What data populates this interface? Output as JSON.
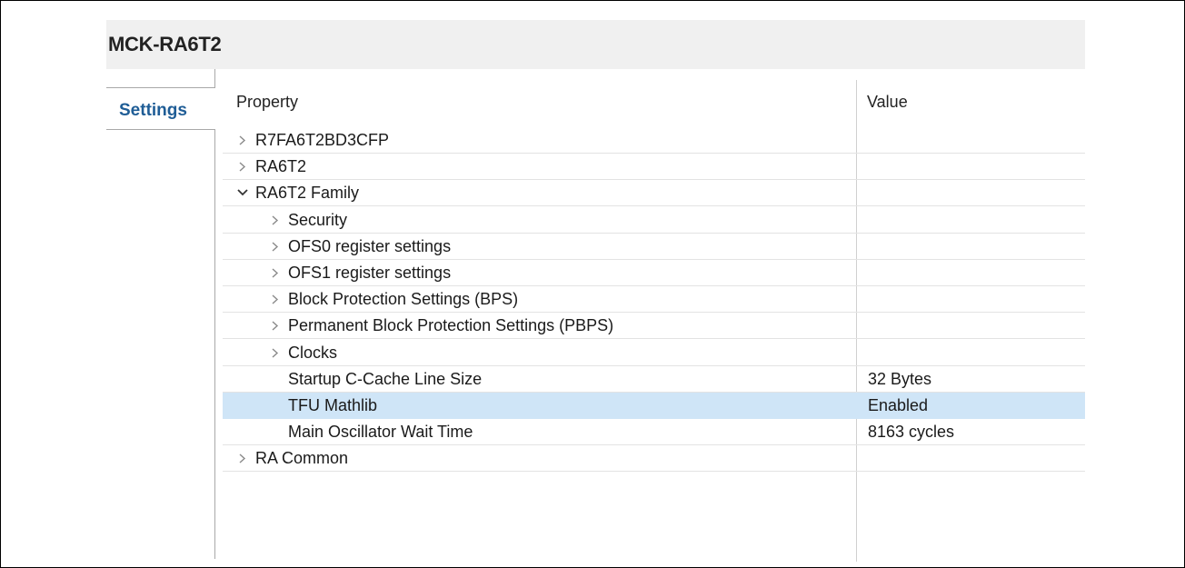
{
  "window": {
    "title": "MCK-RA6T2"
  },
  "tabs": [
    {
      "label": "Settings",
      "active": true
    }
  ],
  "table": {
    "headers": {
      "property": "Property",
      "value": "Value"
    },
    "rows": [
      {
        "label": "R7FA6T2BD3CFP",
        "value": "",
        "level": 0,
        "expander": "collapsed",
        "selected": false
      },
      {
        "label": "RA6T2",
        "value": "",
        "level": 0,
        "expander": "collapsed",
        "selected": false
      },
      {
        "label": "RA6T2 Family",
        "value": "",
        "level": 0,
        "expander": "expanded",
        "selected": false
      },
      {
        "label": "Security",
        "value": "",
        "level": 1,
        "expander": "collapsed",
        "selected": false
      },
      {
        "label": "OFS0 register settings",
        "value": "",
        "level": 1,
        "expander": "collapsed",
        "selected": false
      },
      {
        "label": "OFS1 register settings",
        "value": "",
        "level": 1,
        "expander": "collapsed",
        "selected": false
      },
      {
        "label": "Block Protection Settings (BPS)",
        "value": "",
        "level": 1,
        "expander": "collapsed",
        "selected": false
      },
      {
        "label": "Permanent Block Protection Settings (PBPS)",
        "value": "",
        "level": 1,
        "expander": "collapsed",
        "selected": false
      },
      {
        "label": "Clocks",
        "value": "",
        "level": 1,
        "expander": "collapsed",
        "selected": false
      },
      {
        "label": "Startup C-Cache Line Size",
        "value": "32 Bytes",
        "level": 1,
        "expander": "none",
        "selected": false
      },
      {
        "label": "TFU Mathlib",
        "value": "Enabled",
        "level": 1,
        "expander": "none",
        "selected": true
      },
      {
        "label": "Main Oscillator Wait Time",
        "value": "8163 cycles",
        "level": 1,
        "expander": "none",
        "selected": false
      },
      {
        "label": "RA Common",
        "value": "",
        "level": 0,
        "expander": "collapsed",
        "selected": false
      }
    ]
  },
  "colors": {
    "selection": "#cfe5f7",
    "tab_text": "#1f5d96",
    "title_bar": "#f0f0f0"
  }
}
